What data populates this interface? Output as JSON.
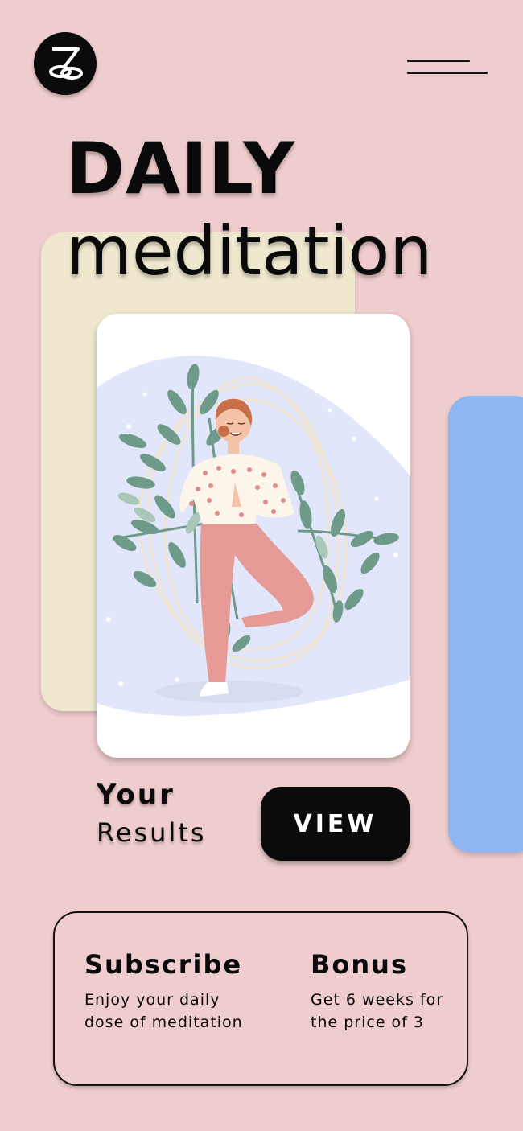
{
  "header": {
    "logo_icon": "lotus-logo-icon",
    "menu_icon": "hamburger-menu-icon"
  },
  "hero": {
    "title_line1": "DAILY",
    "title_line2": "meditation",
    "illustration": "woman-tree-pose-yoga-illustration"
  },
  "results": {
    "label_line1": "Your",
    "label_line2": "Results",
    "view_button": "VIEW"
  },
  "info": {
    "subscribe": {
      "heading": "Subscribe",
      "text": "Enjoy your daily dose of meditation"
    },
    "bonus": {
      "heading": "Bonus",
      "text": "Get 6 weeks for the price of 3"
    }
  },
  "colors": {
    "background": "#efcccd",
    "card_beige": "#efe8cf",
    "card_blue": "#8fb6f3",
    "button": "#0b0b0b"
  }
}
